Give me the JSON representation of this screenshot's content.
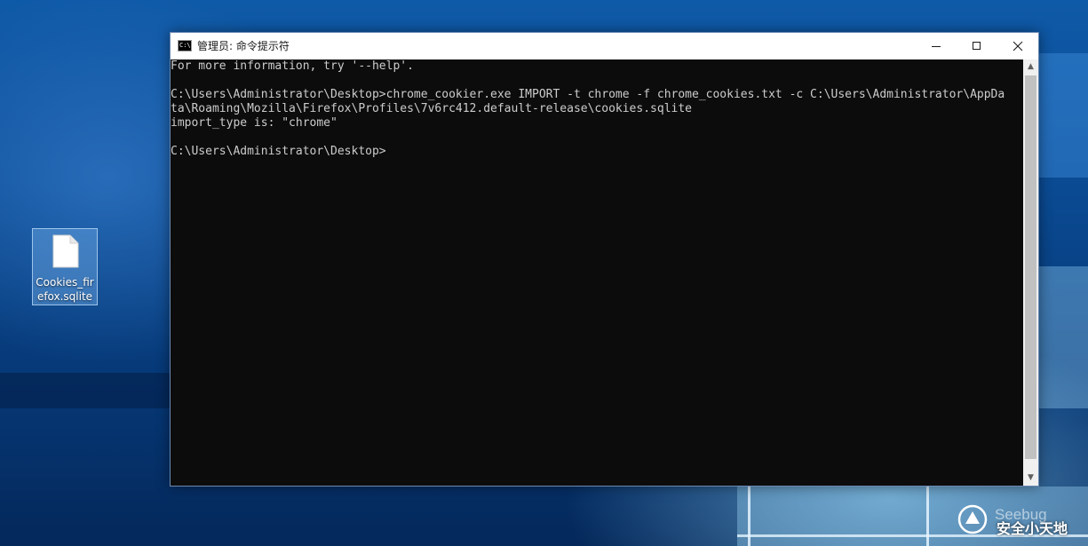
{
  "desktop": {
    "icon": {
      "label": "Cookies_firefox.sqlite",
      "icon": "file-icon"
    }
  },
  "window": {
    "title": "管理员: 命令提示符",
    "app_icon": "cmd-icon",
    "controls": {
      "minimize_icon": "minimize-icon",
      "maximize_icon": "maximize-icon",
      "close_icon": "close-icon"
    }
  },
  "console": {
    "lines": [
      "For more information, try '--help'.",
      "",
      "C:\\Users\\Administrator\\Desktop>chrome_cookier.exe IMPORT -t chrome -f chrome_cookies.txt -c C:\\Users\\Administrator\\AppDa",
      "ta\\Roaming\\Mozilla\\Firefox\\Profiles\\7v6rc412.default-release\\cookies.sqlite",
      "import_type is: \"chrome\"",
      "",
      "C:\\Users\\Administrator\\Desktop>"
    ]
  },
  "watermark": {
    "text_en": "Seebug",
    "text_cn": "安全小天地"
  },
  "colors": {
    "console_bg": "#0c0c0c",
    "console_fg": "#cccccc",
    "titlebar_bg": "#ffffff"
  }
}
